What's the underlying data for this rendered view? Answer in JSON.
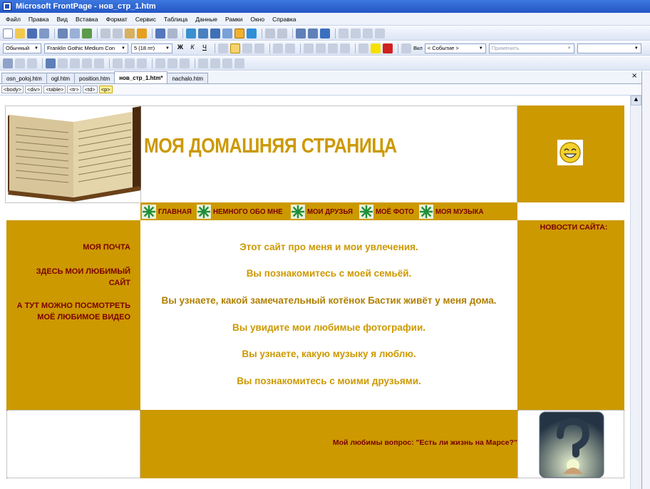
{
  "window": {
    "title": "Microsoft FrontPage - нов_стр_1.htm"
  },
  "menu": [
    "Файл",
    "Правка",
    "Вид",
    "Вставка",
    "Формат",
    "Сервис",
    "Таблица",
    "Данные",
    "Рамки",
    "Окно",
    "Справка"
  ],
  "format_toolbar": {
    "style": "Обычный",
    "font": "Franklin Gothic Medium Con",
    "size": "5  (18 пт)",
    "on_label": "Вкл",
    "event": "< Событие >",
    "apply": "Применить"
  },
  "tabs": [
    {
      "label": "osn_poloj.htm",
      "active": false
    },
    {
      "label": "ogl.htm",
      "active": false
    },
    {
      "label": "position.htm",
      "active": false
    },
    {
      "label": "нов_стр_1.htm*",
      "active": true
    },
    {
      "label": "nachalo.htm",
      "active": false
    }
  ],
  "tab_close": "×",
  "breadcrumb": [
    "<body>",
    "<div>",
    "<table>",
    "<tr>",
    "<td>",
    "<p>"
  ],
  "page": {
    "title": "МОЯ ДОМАШНЯЯ СТРАНИЦА",
    "nav": [
      "ГЛАВНАЯ",
      "НЕМНОГО ОБО МНЕ",
      "МОИ ДРУЗЬЯ",
      "МОЁ ФОТО",
      "МОЯ МУЗЫКА"
    ],
    "left": [
      "МОЯ ПОЧТА",
      "ЗДЕСЬ МОИ ЛЮБИМЫЙ САЙТ",
      "А ТУТ МОЖНО ПОСМОТРЕТЬ МОЁ ЛЮБИМОЕ ВИДЕО"
    ],
    "center": [
      "Этот сайт про меня и мои увлечения.",
      "Вы познакомитесь с моей семьёй.",
      "Вы узнаете, какой замечательный котёнок Бастик живёт у меня дома.",
      "Вы увидите мои любимые фотографии.",
      "Вы узнаете, какую музыку я люблю.",
      "Вы познакомитесь с моими друзьями."
    ],
    "news_title": "НОВОСТИ САЙТА:",
    "question": "Мой любимы вопрос: \"Есть ли жизнь на Марсе?\""
  },
  "colors": {
    "gold": "#cc9900",
    "maroon": "#7a0000",
    "title_bar": "#2456c5"
  }
}
